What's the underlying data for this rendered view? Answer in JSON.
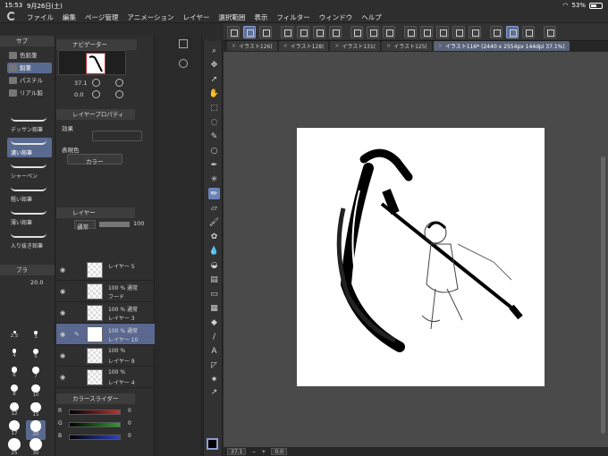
{
  "status": {
    "time": "15:53",
    "date": "9月26日(土)",
    "battery": "53%",
    "battery_level": 0.53
  },
  "menu": [
    "ファイル",
    "編集",
    "ページ管理",
    "アニメーション",
    "レイヤー",
    "選択範囲",
    "表示",
    "フィルター",
    "ウィンドウ",
    "ヘルプ"
  ],
  "tabs": [
    {
      "label": "イラスト126(",
      "active": false
    },
    {
      "label": "イラスト128(",
      "active": false
    },
    {
      "label": "イラスト131(",
      "active": false
    },
    {
      "label": "イラスト125(",
      "active": false
    },
    {
      "label": "イラスト116* (2440 x 2554px 144dpi 37.1%)",
      "active": true
    }
  ],
  "subtool": {
    "header": "サブ",
    "pen_items": [
      "色鉛筆",
      "鉛筆",
      "パステル",
      "リアル鉛"
    ],
    "brushes": [
      "デッサン鉛筆",
      "濃い鉛筆",
      "シャーペン",
      "粗い鉛筆",
      "薄い鉛筆",
      "入り抜き鉛筆"
    ]
  },
  "brush_size": {
    "header": "ブラ",
    "current": "20.0",
    "sizes": [
      "2.5",
      "3",
      "4",
      "5",
      "6",
      "7",
      "8",
      "10",
      "12",
      "15",
      "17",
      "20",
      "25",
      "30",
      "40",
      "50"
    ]
  },
  "navigator": {
    "header": "ナビゲーター",
    "zoom": "37.1",
    "rotation": "0.0"
  },
  "layer_property": {
    "header": "レイヤープロパティ",
    "effect_label": "効果",
    "color_label": "表現色",
    "color_value": "カラー"
  },
  "layers": {
    "header": "レイヤー",
    "blend_mode": "通常",
    "opacity": "100",
    "items": [
      {
        "line1": "レイヤー 5",
        "line2": "",
        "active": false
      },
      {
        "line1": "100 % 通常",
        "line2": "フード",
        "active": false
      },
      {
        "line1": "100 % 通常",
        "line2": "レイヤー 3",
        "active": false
      },
      {
        "line1": "100 % 通常",
        "line2": "レイヤー 10",
        "active": true
      },
      {
        "line1": "100 %",
        "line2": "レイヤー 9",
        "active": false
      },
      {
        "line1": "100 %",
        "line2": "レイヤー 4",
        "active": false
      }
    ]
  },
  "color_slider": {
    "header": "カラースライダー",
    "channels": [
      {
        "name": "R",
        "value": "0",
        "color": "#c03030"
      },
      {
        "name": "G",
        "value": "0",
        "color": "#30a030"
      },
      {
        "name": "B",
        "value": "0",
        "color": "#3040c0"
      }
    ]
  },
  "bottom": {
    "zoom": "37.1",
    "angle": "0.0"
  },
  "colors": {
    "accent": "#596a90",
    "panel": "#2f2f2f",
    "canvas_bg": "#4a4a4a"
  }
}
